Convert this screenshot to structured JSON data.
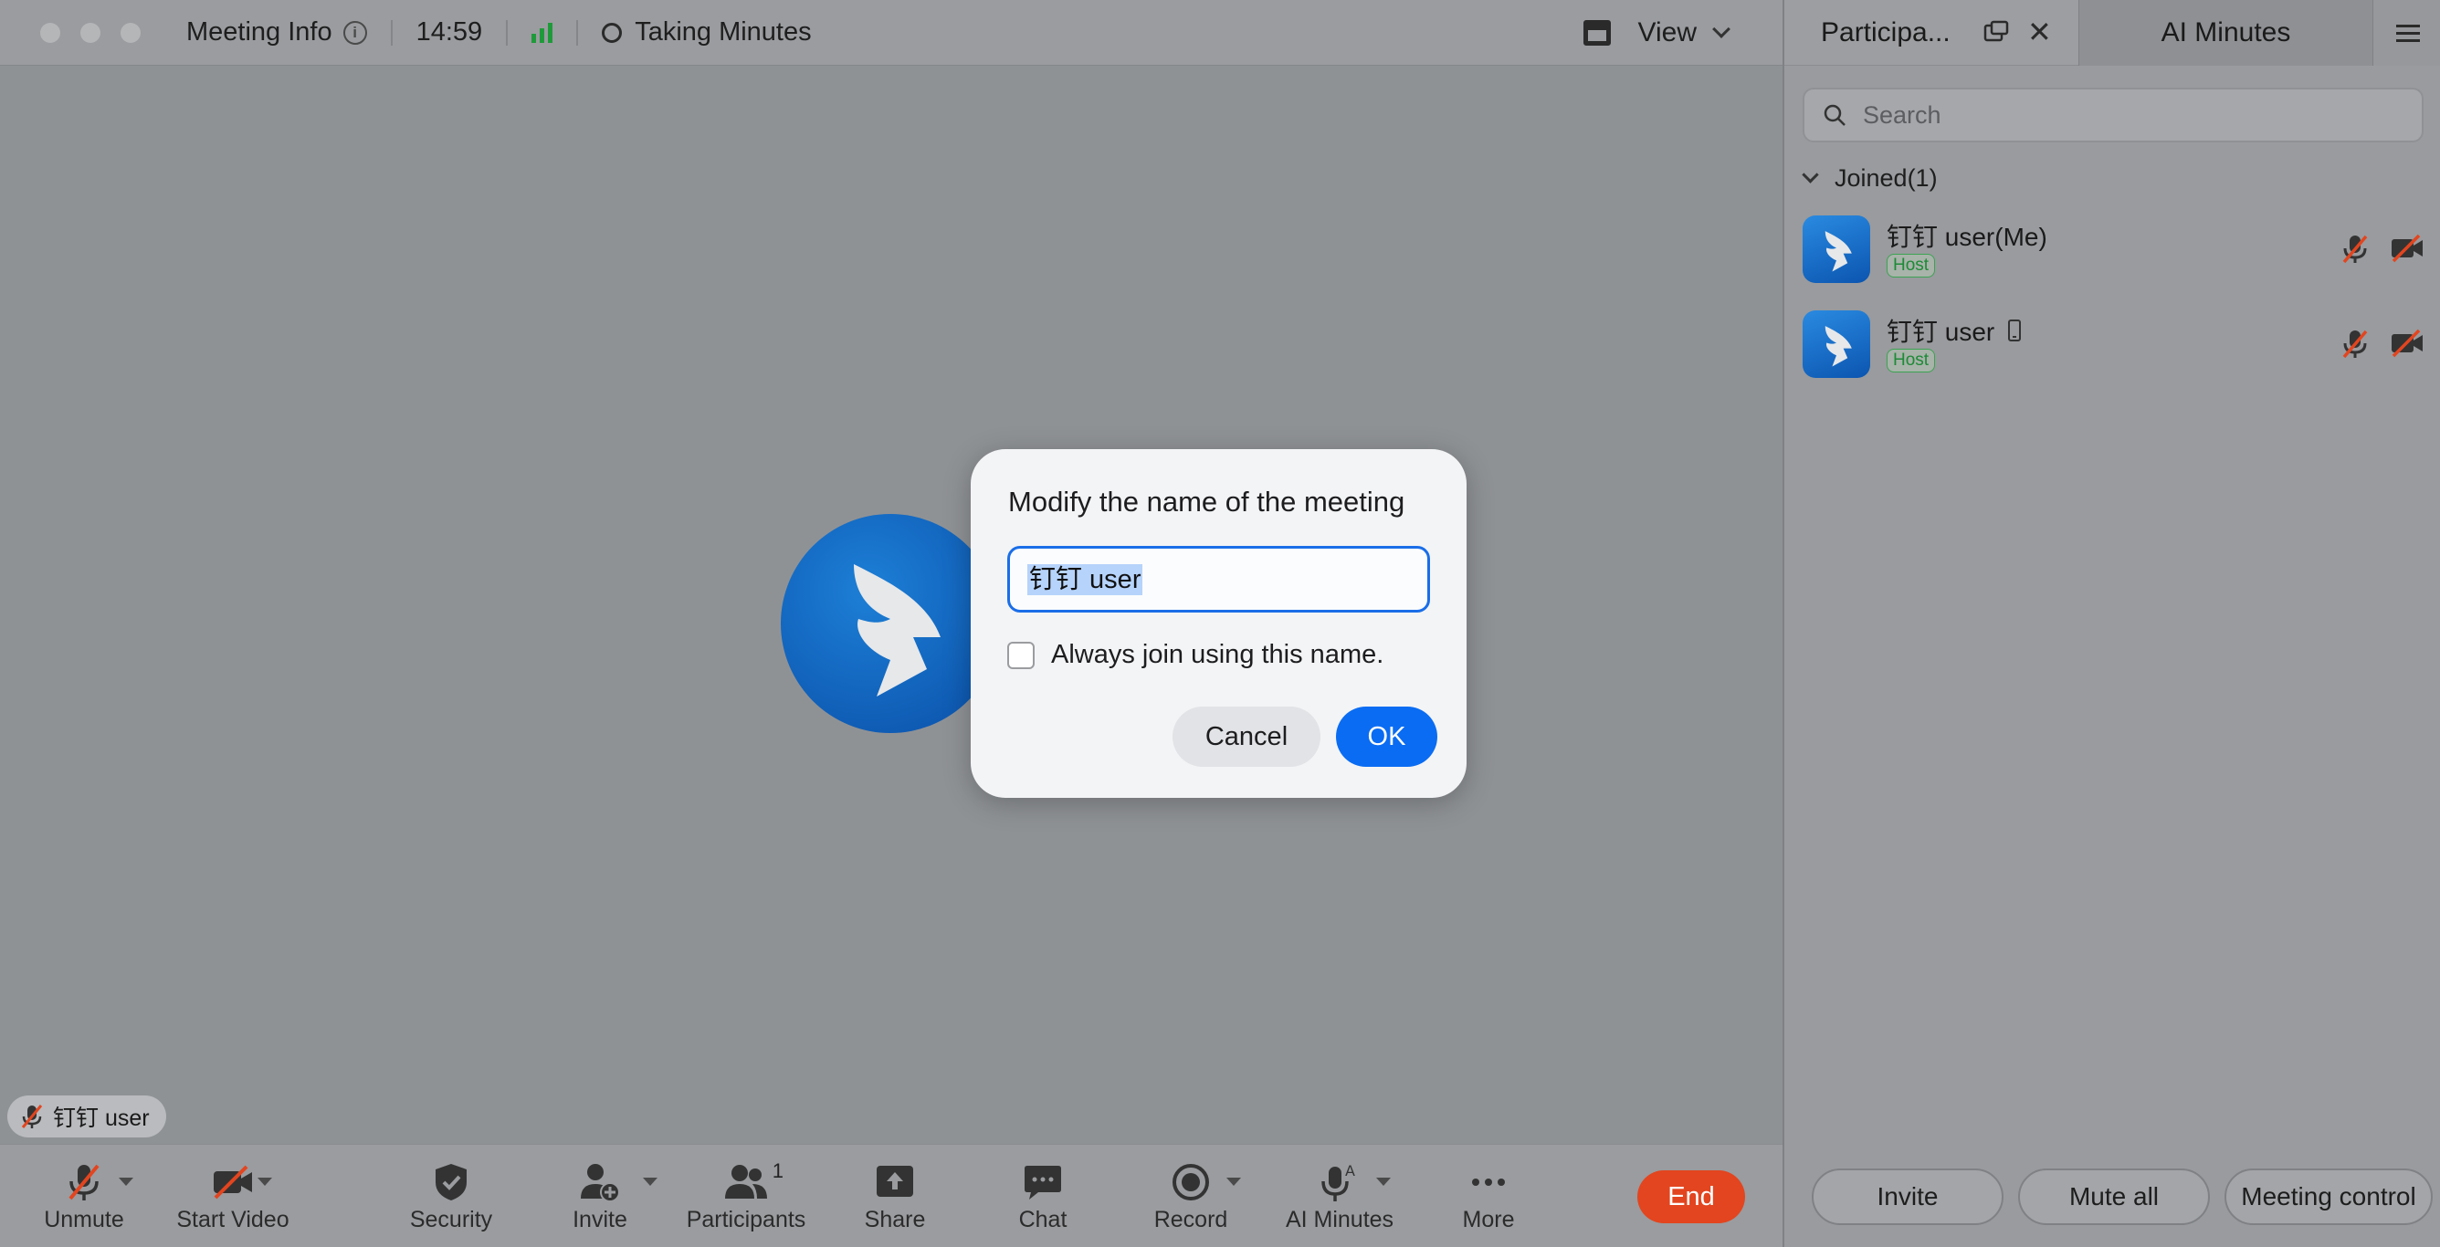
{
  "titlebar": {
    "meeting_info": "Meeting Info",
    "timer": "14:59",
    "status": "Taking Minutes",
    "view": "View"
  },
  "main": {
    "name_tag": "钉钉 user"
  },
  "toolbar": {
    "unmute": "Unmute",
    "start_video": "Start Video",
    "security": "Security",
    "invite": "Invite",
    "participants": "Participants",
    "participants_count": "1",
    "share": "Share",
    "chat": "Chat",
    "record": "Record",
    "ai_minutes": "AI Minutes",
    "more": "More",
    "end": "End"
  },
  "dialog": {
    "title": "Modify the name of the meeting",
    "input_value": "钉钉 user",
    "always_label": "Always join using this name.",
    "always_checked": false,
    "cancel": "Cancel",
    "ok": "OK"
  },
  "panel": {
    "tabs": {
      "participants": "Participa...",
      "ai_minutes": "AI Minutes"
    },
    "search_placeholder": "Search",
    "joined": "Joined(1)",
    "participants": [
      {
        "name": "钉钉 user(Me)",
        "role": "Host"
      },
      {
        "name": "钉钉 user",
        "role": "Host"
      }
    ],
    "buttons": {
      "invite": "Invite",
      "mute_all": "Mute all",
      "meeting_control": "Meeting control"
    }
  },
  "colors": {
    "accent": "#0a6cf2",
    "end": "#e2451f",
    "host": "#1d8a36",
    "signal": "#1f9a3a"
  }
}
